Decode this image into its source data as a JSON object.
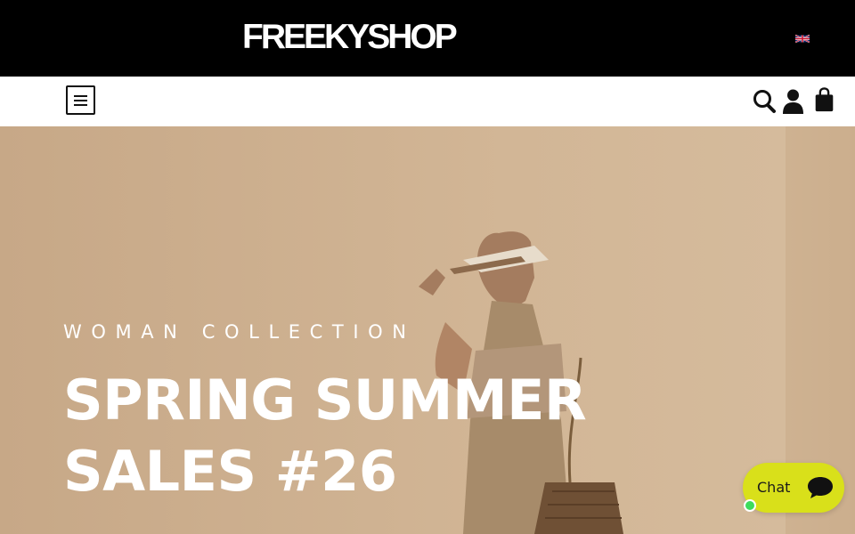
{
  "header": {
    "logo_text": "FREEKYSHOP",
    "language_flag": "uk-flag-icon"
  },
  "nav": {
    "menu_icon": "hamburger-menu-icon",
    "icons": [
      "search-icon",
      "account-icon",
      "cart-icon"
    ]
  },
  "hero": {
    "eyebrow": "WOMAN COLLECTION",
    "title_line1": "SPRING SUMMER",
    "title_line2": "SALES #26",
    "image": "woman in beige outfit with visor hat and woven bag"
  },
  "chat": {
    "label": "Chat",
    "icon": "chat-bubble-icon",
    "status": "online"
  },
  "colors": {
    "topbar_bg": "#000000",
    "hero_bg": "#c8aa89",
    "chat_bg": "#d9e01a",
    "status_online": "#3ddc5c"
  }
}
